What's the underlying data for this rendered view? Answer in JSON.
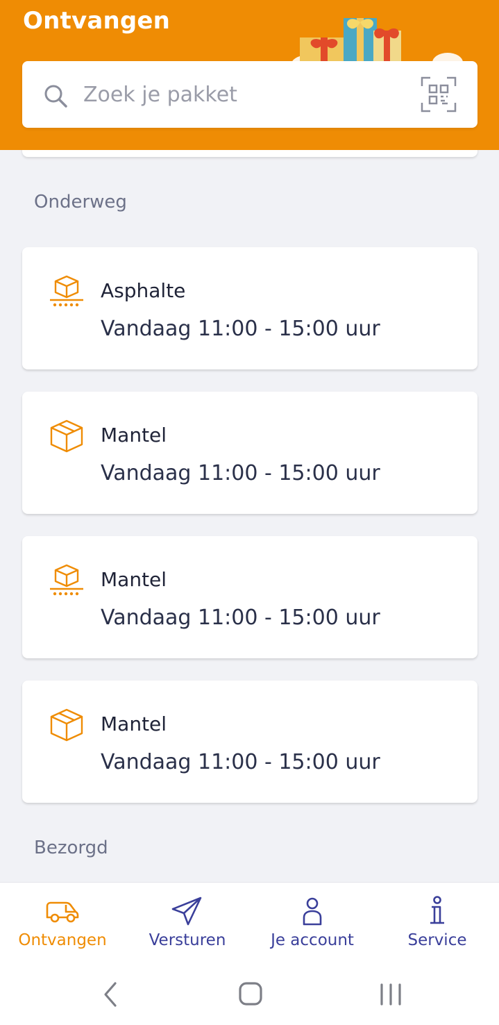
{
  "header": {
    "title": "Ontvangen",
    "brand_color": "#ef8c04"
  },
  "search": {
    "placeholder": "Zoek je pakket",
    "value": ""
  },
  "sections": {
    "in_transit": "Onderweg",
    "delivered": "Bezorgd"
  },
  "parcels": [
    {
      "name": "Asphalte",
      "time": "Vandaag 11:00 - 15:00 uur",
      "icon": "package-conveyor-icon"
    },
    {
      "name": "Mantel",
      "time": "Vandaag 11:00 - 15:00 uur",
      "icon": "package-box-icon"
    },
    {
      "name": "Mantel",
      "time": "Vandaag 11:00 - 15:00 uur",
      "icon": "package-conveyor-icon"
    },
    {
      "name": "Mantel",
      "time": "Vandaag 11:00 - 15:00 uur",
      "icon": "package-box-icon"
    }
  ],
  "nav": {
    "receive": "Ontvangen",
    "send": "Versturen",
    "account": "Je account",
    "service": "Service",
    "active_color": "#ef8c04",
    "inactive_color": "#3a3f9a"
  }
}
